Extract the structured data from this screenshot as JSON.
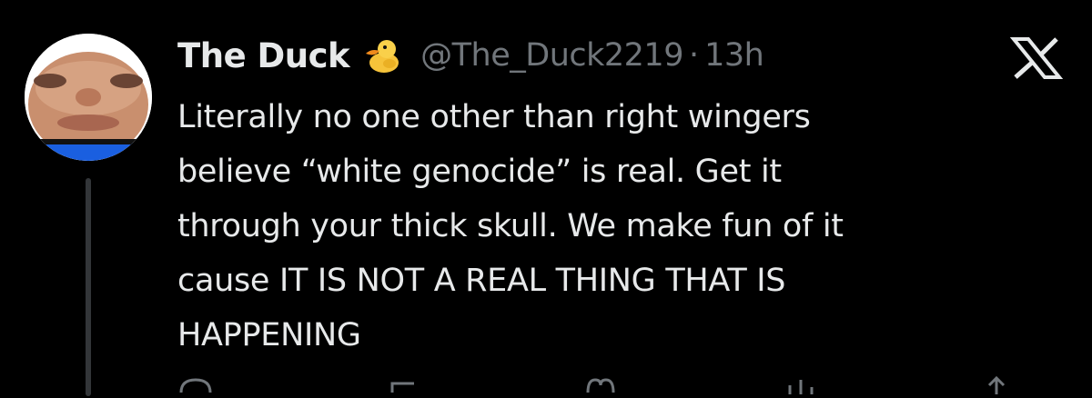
{
  "tweet": {
    "display_name": "The Duck",
    "verified_emoji": "duck-emoji",
    "handle": "@The_Duck2219",
    "separator": "·",
    "timestamp": "13h",
    "text": "Literally no one other than right wingers\nbelieve “white genocide” is real. Get it\nthrough your thick skull. We make fun of it\ncause IT IS NOT A REAL THING THAT IS\nHAPPENING"
  },
  "icons": {
    "brand": "x-logo-icon",
    "actions": [
      "reply-icon",
      "retweet-icon",
      "like-icon",
      "views-icon",
      "share-icon"
    ]
  },
  "colors": {
    "background": "#000000",
    "primary_text": "#e7e9ea",
    "secondary_text": "#71767b",
    "thread_line": "#333639"
  }
}
